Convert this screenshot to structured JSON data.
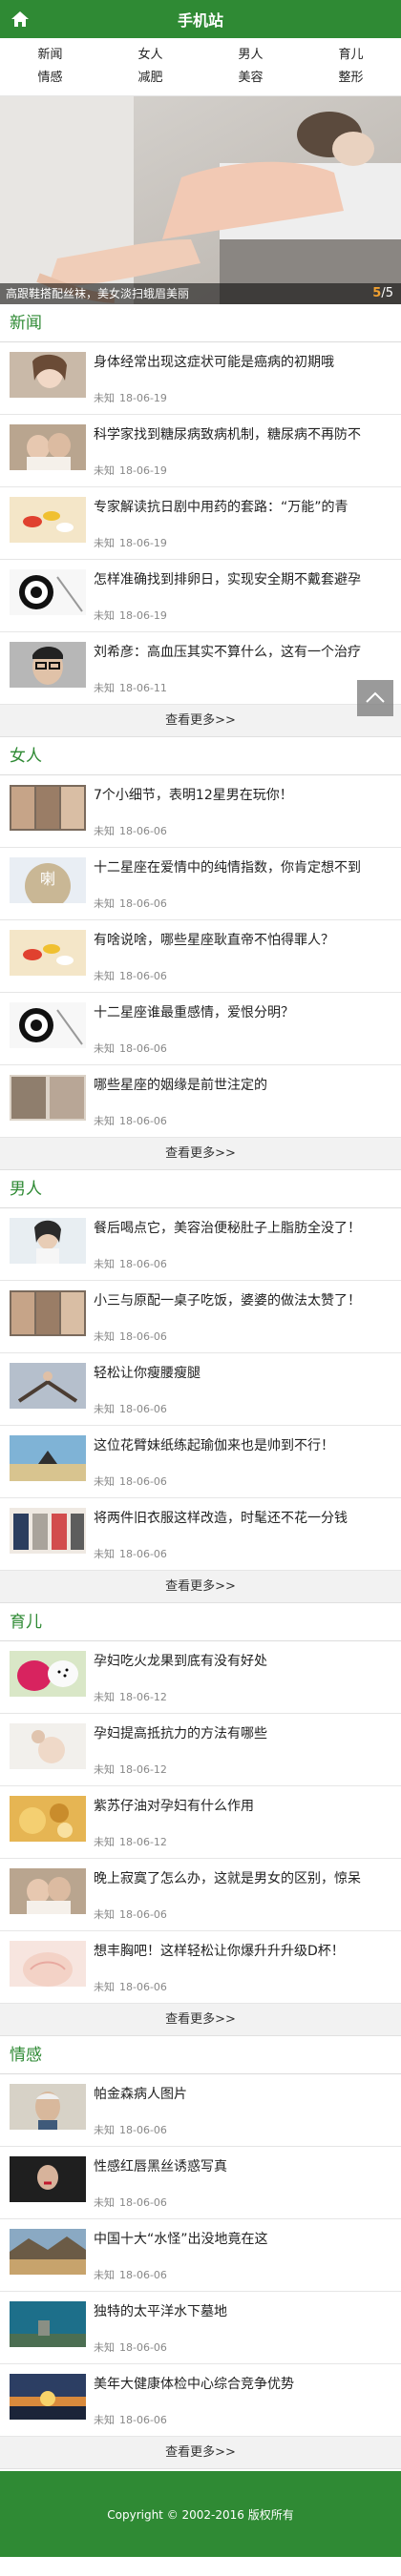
{
  "header": {
    "title": "手机站"
  },
  "nav": [
    "新闻",
    "女人",
    "男人",
    "育儿",
    "情感",
    "减肥",
    "美容",
    "整形"
  ],
  "slider": {
    "caption": "高跟鞋搭配丝袜，美女淡扫蛾眉美丽",
    "current": "5",
    "separator": "/",
    "total": "5"
  },
  "sections": [
    {
      "title": "新闻",
      "items": [
        {
          "title": "身体经常出现这症状可能是癌病的初期哦",
          "source": "未知",
          "date": "18-06-19",
          "thumb": "woman-pale"
        },
        {
          "title": "科学家找到糖尿病致病机制，糖尿病不再防不",
          "source": "未知",
          "date": "18-06-19",
          "thumb": "couple"
        },
        {
          "title": "专家解读抗日剧中用药的套路：“万能”的青",
          "source": "未知",
          "date": "18-06-19",
          "thumb": "pills"
        },
        {
          "title": "怎样准确找到排卵日，实现安全期不戴套避孕",
          "source": "未知",
          "date": "18-06-19",
          "thumb": "target"
        },
        {
          "title": "刘希彦：高血压其实不算什么，这有一个治疗",
          "source": "未知",
          "date": "18-06-11",
          "thumb": "man-glasses"
        }
      ],
      "more": "查看更多>>"
    },
    {
      "title": "女人",
      "items": [
        {
          "title": "7个小细节，表明12星男在玩你！",
          "source": "未知",
          "date": "18-06-06",
          "thumb": "collage"
        },
        {
          "title": "十二星座在爱情中的纯情指数，你肯定想不到",
          "source": "未知",
          "date": "18-06-06",
          "thumb": "moon"
        },
        {
          "title": "有啥说啥，哪些星座耿直帝不怕得罪人？",
          "source": "未知",
          "date": "18-06-06",
          "thumb": "pills"
        },
        {
          "title": "十二星座谁最重感情，爱恨分明？",
          "source": "未知",
          "date": "18-06-06",
          "thumb": "target"
        },
        {
          "title": "哪些星座的姻缘是前世注定的",
          "source": "未知",
          "date": "18-06-06",
          "thumb": "collage2"
        }
      ],
      "more": "查看更多>>"
    },
    {
      "title": "男人",
      "items": [
        {
          "title": "餐后喝点它，美容治便秘肚子上脂肪全没了！",
          "source": "未知",
          "date": "18-06-06",
          "thumb": "woman-white"
        },
        {
          "title": "小三与原配一桌子吃饭，婆婆的做法太赞了！",
          "source": "未知",
          "date": "18-06-06",
          "thumb": "collage"
        },
        {
          "title": "轻松让你瘦腰瘦腿",
          "source": "未知",
          "date": "18-06-06",
          "thumb": "yoga"
        },
        {
          "title": "这位花臂妹纸练起瑜伽来也是帅到不行！",
          "source": "未知",
          "date": "18-06-06",
          "thumb": "beach"
        },
        {
          "title": "将两件旧衣服这样改造，时髦还不花一分钱",
          "source": "未知",
          "date": "18-06-06",
          "thumb": "fashion"
        }
      ],
      "more": "查看更多>>"
    },
    {
      "title": "育儿",
      "items": [
        {
          "title": "孕妇吃火龙果到底有没有好处",
          "source": "未知",
          "date": "18-06-12",
          "thumb": "dragonfruit"
        },
        {
          "title": "孕妇提高抵抗力的方法有哪些",
          "source": "未知",
          "date": "18-06-12",
          "thumb": "pregnant"
        },
        {
          "title": "紫苏仔油对孕妇有什么作用",
          "source": "未知",
          "date": "18-06-12",
          "thumb": "oil"
        },
        {
          "title": "晚上寂寞了怎么办，这就是男女的区别，惊呆",
          "source": "未知",
          "date": "18-06-06",
          "thumb": "couple"
        },
        {
          "title": "想丰胸吧！这样轻松让你爆升升升级D杯！",
          "source": "未知",
          "date": "18-06-06",
          "thumb": "belly"
        }
      ],
      "more": "查看更多>>"
    },
    {
      "title": "情感",
      "items": [
        {
          "title": "帕金森病人图片",
          "source": "未知",
          "date": "18-06-06",
          "thumb": "old-man"
        },
        {
          "title": "性感红唇黑丝诱惑写真",
          "source": "未知",
          "date": "18-06-06",
          "thumb": "dark-woman"
        },
        {
          "title": "中国十大“水怪”出没地竟在这",
          "source": "未知",
          "date": "18-06-06",
          "thumb": "lake"
        },
        {
          "title": "独特的太平洋水下墓地",
          "source": "未知",
          "date": "18-06-06",
          "thumb": "underwater"
        },
        {
          "title": "美年大健康体检中心综合竞争优势",
          "source": "未知",
          "date": "18-06-06",
          "thumb": "sunset"
        }
      ],
      "more": "查看更多>>"
    }
  ],
  "footer": {
    "text": "Copyright © 2002-2016 版权所有"
  },
  "colors": {
    "brand_green": "#2f8a34",
    "counter_orange": "#f0a030"
  }
}
